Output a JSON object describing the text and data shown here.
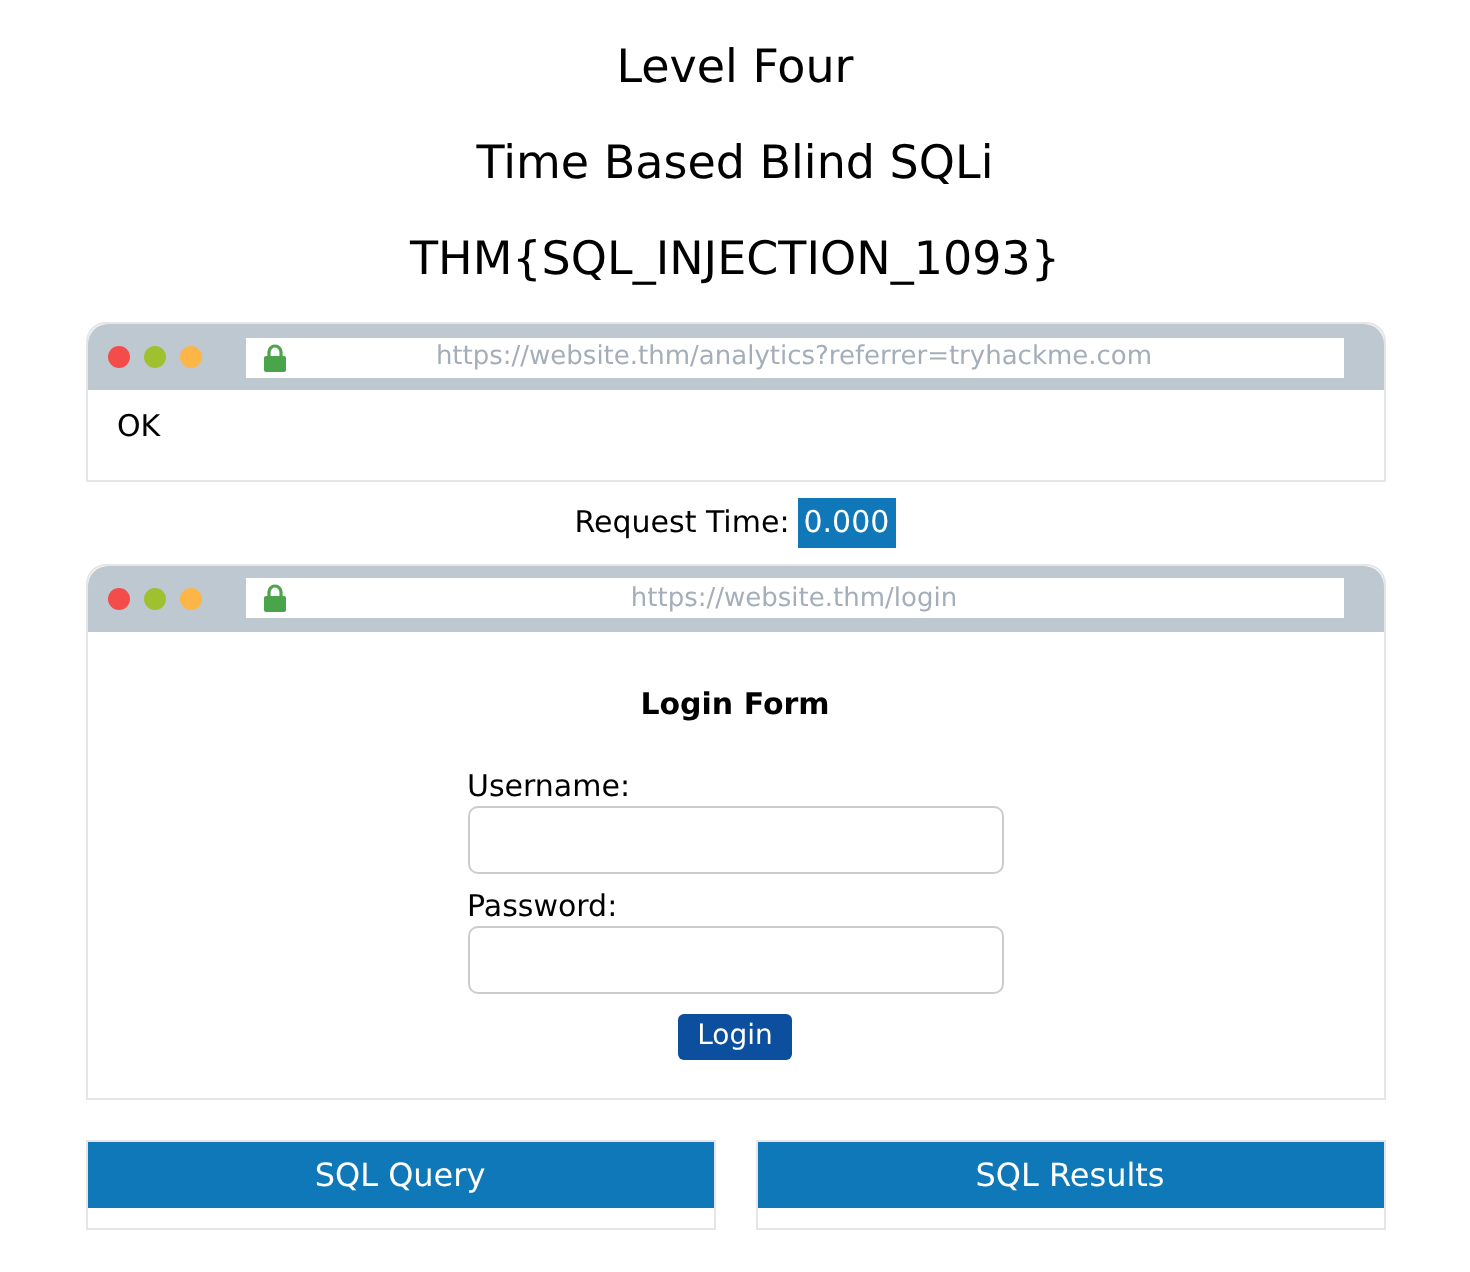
{
  "headings": [
    "Level Four",
    "Time Based Blind SQLi",
    "THM{SQL_INJECTION_1093}"
  ],
  "analytics_browser": {
    "url": "https://website.thm/analytics?referrer=tryhackme.com",
    "body": "OK"
  },
  "request_time": {
    "label": "Request Time:",
    "value": "0.000"
  },
  "login_browser": {
    "url": "https://website.thm/login",
    "form_title": "Login Form",
    "fields": [
      {
        "label": "Username:"
      },
      {
        "label": "Password:"
      }
    ],
    "submit": "Login"
  },
  "panels": [
    {
      "title": "SQL Query"
    },
    {
      "title": "SQL Results"
    }
  ]
}
